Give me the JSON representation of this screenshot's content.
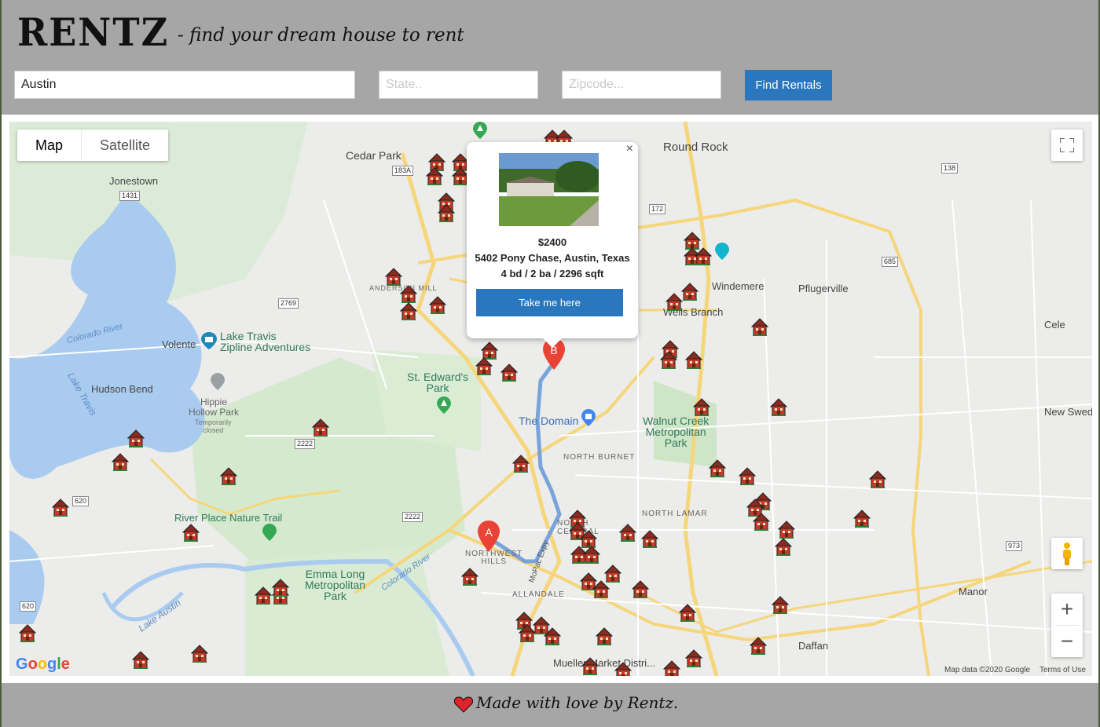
{
  "header": {
    "logo": "RENTZ",
    "tagline": "- find your dream house to rent"
  },
  "search": {
    "city_value": "Austin",
    "state_placeholder": "State..",
    "zip_placeholder": "Zipcode...",
    "find_label": "Find Rentals"
  },
  "map": {
    "type_map": "Map",
    "type_satellite": "Satellite",
    "zoom_in": "+",
    "zoom_out": "−",
    "google": "Google",
    "attribution": "Map data ©2020 Google",
    "terms": "Terms of Use",
    "marker_a": "A",
    "marker_b": "B",
    "places": {
      "cedar_park": "Cedar Park",
      "round_rock": "Round Rock",
      "jonestown": "Jonestown",
      "windemere": "Windemere",
      "pflugerville": "Pflugerville",
      "wells_branch": "Wells Branch",
      "cele": "Cele",
      "volente": "Volente",
      "lake_travis_zipline": "Lake Travis\nZipline Adventures",
      "hudson_bend": "Hudson Bend",
      "st_edwards": "St. Edward's\nPark",
      "the_domain": "The Domain",
      "walnut_creek": "Walnut Creek\nMetropolitan\nPark",
      "new_swed": "New Swed",
      "north_burnet": "NORTH BURNET",
      "north_lamar": "NORTH LAMAR",
      "north_central": "NORTH\nCENTRAL",
      "river_place": "River Place Nature Trail",
      "emma_long": "Emma Long\nMetropolitan\nPark",
      "northwest_hills": "NORTHWEST\nHILLS",
      "allandale": "ALLANDALE",
      "manor": "Manor",
      "daffan": "Daffan",
      "hippie_hollow": "Hippie\nHollow Park",
      "temporarily_closed": "Temporarily\nclosed",
      "anderson_mill": "ANDERSON MILL",
      "colorado_river": "Colorado River",
      "lake_travis": "Lake Travis",
      "lake_austin": "Lake Austin",
      "mopac": "MoPac Expy",
      "mueller": "Mueller Market Distri..."
    }
  },
  "popup": {
    "price": "$2400",
    "address": "5402 Pony Chase, Austin, Texas",
    "details": "4 bd / 2 ba / 2296 sqft",
    "button": "Take me here",
    "close": "×"
  },
  "footer": {
    "text": "Made with love by Rentz."
  },
  "colors": {
    "button": "#2a77bd",
    "header_bg": "#a6a6a6",
    "marker": "#ea4335",
    "house": "#c0392b"
  },
  "icons": [
    "house-marker-icon",
    "fullscreen-icon",
    "pegman-icon",
    "heart-icon",
    "camera-icon",
    "park-icon",
    "shopping-icon"
  ]
}
